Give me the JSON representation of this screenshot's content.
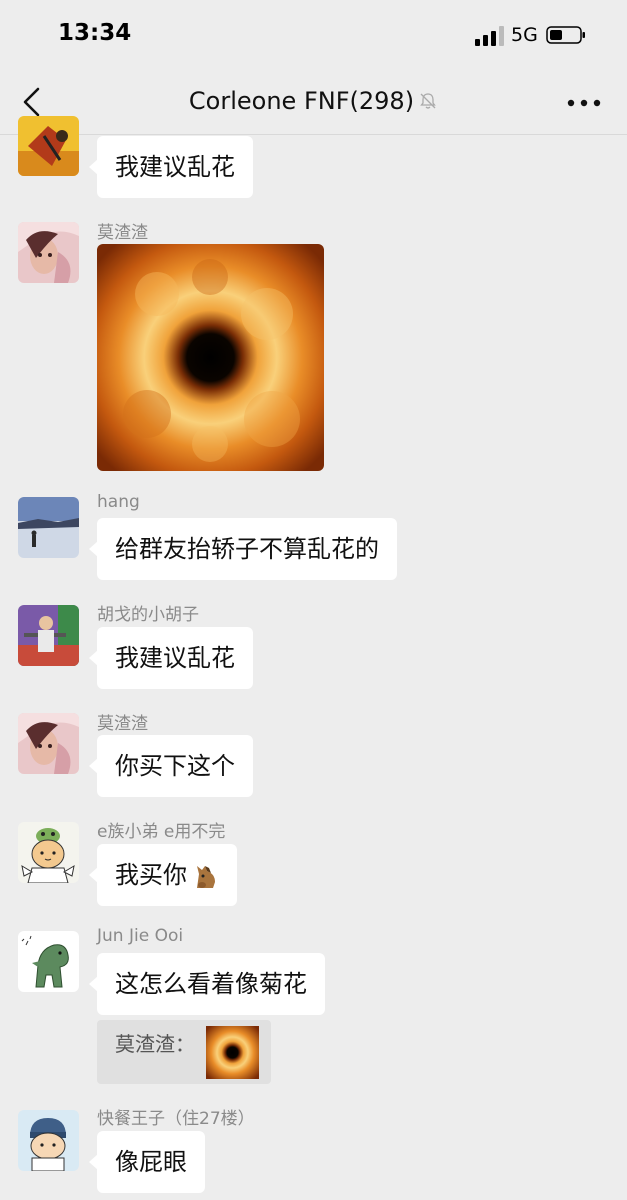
{
  "status_bar": {
    "time": "13:34",
    "network": "5G"
  },
  "header": {
    "title": "Corleone FNF",
    "member_count": "(298)"
  },
  "messages": [
    {
      "text": "我建议乱花"
    },
    {
      "sender": "莫渣渣"
    },
    {
      "sender": "hang",
      "text": "给群友抬轿子不算乱花的"
    },
    {
      "sender": "胡戈的小胡子",
      "text": "我建议乱花"
    },
    {
      "sender": "莫渣渣",
      "text": "你买下这个"
    },
    {
      "sender": "e族小弟 e用不完",
      "text": "我买你"
    },
    {
      "sender": "Jun Jie Ooi",
      "text": "这怎么看着像菊花",
      "quote_author": "莫渣渣："
    },
    {
      "sender": "快餐王子（住27楼）",
      "text": "像屁眼"
    }
  ],
  "icons": {
    "back": "chevron-left-icon",
    "mute": "bell-muted-icon",
    "more": "more-dots-icon",
    "emoji": "horse-face-emoji"
  },
  "colors": {
    "background": "#ededed",
    "bubble": "#ffffff",
    "sender_text": "#8a8a8a"
  }
}
